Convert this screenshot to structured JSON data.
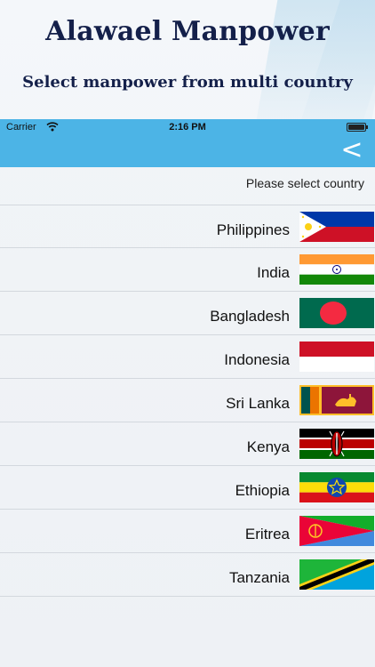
{
  "promo": {
    "title": "Alawael Manpower",
    "subtitle": "Select manpower from multi country"
  },
  "status_bar": {
    "carrier": "Carrier",
    "time": "2:16 PM"
  },
  "nav": {
    "back_icon": "chevron-left-icon",
    "accent_color": "#4cb4e6"
  },
  "section_header": "Please select country",
  "countries": [
    {
      "name": "Philippines",
      "flag": "philippines-flag-icon"
    },
    {
      "name": "India",
      "flag": "india-flag-icon"
    },
    {
      "name": "Bangladesh",
      "flag": "bangladesh-flag-icon"
    },
    {
      "name": "Indonesia",
      "flag": "indonesia-flag-icon"
    },
    {
      "name": "Sri Lanka",
      "flag": "sri-lanka-flag-icon"
    },
    {
      "name": "Kenya",
      "flag": "kenya-flag-icon"
    },
    {
      "name": "Ethiopia",
      "flag": "ethiopia-flag-icon"
    },
    {
      "name": "Eritrea",
      "flag": "eritrea-flag-icon"
    },
    {
      "name": "Tanzania",
      "flag": "tanzania-flag-icon"
    }
  ]
}
